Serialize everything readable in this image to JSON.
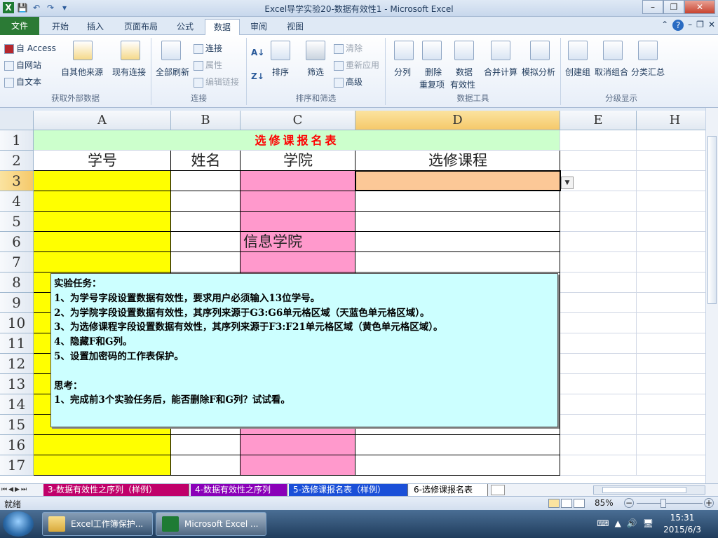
{
  "window": {
    "title": "Excel导学实验20-数据有效性1 - Microsoft Excel",
    "qat": [
      "💾",
      "↶",
      "↷",
      "▾"
    ],
    "controls": {
      "minimize": "–",
      "restore": "❐",
      "close": "✕"
    }
  },
  "tabs": [
    "文件",
    "开始",
    "插入",
    "页面布局",
    "公式",
    "数据",
    "审阅",
    "视图"
  ],
  "active_tab": "数据",
  "tab_right": [
    "⌃",
    "?",
    "–",
    "❐",
    "✕"
  ],
  "ribbon": {
    "get_external": {
      "label": "获取外部数据",
      "access": "自 Access",
      "web": "自网站",
      "text": "自文本",
      "other": "自其他来源",
      "existing": "现有连接"
    },
    "connections": {
      "label": "连接",
      "refresh_all": "全部刷新",
      "connections": "连接",
      "properties": "属性",
      "edit_links": "编辑链接"
    },
    "sort_filter": {
      "label": "排序和筛选",
      "sort_asc": "A↓",
      "sort_desc": "Z↓",
      "sort": "排序",
      "filter": "筛选",
      "clear": "清除",
      "reapply": "重新应用",
      "advanced": "高级"
    },
    "data_tools": {
      "label": "数据工具",
      "split": "分列",
      "remove_dup_1": "删除",
      "remove_dup_2": "重复项",
      "validation_1": "数据",
      "validation_2": "有效性",
      "consolidate": "合并计算",
      "what_if": "模拟分析"
    },
    "outline": {
      "label": "分级显示",
      "group": "创建组",
      "ungroup": "取消组合",
      "subtotal": "分类汇总"
    }
  },
  "columns": [
    "A",
    "B",
    "C",
    "D",
    "E",
    "H"
  ],
  "rows": [
    "1",
    "2",
    "3",
    "4",
    "5",
    "6",
    "7",
    "8",
    "9",
    "10",
    "11",
    "12",
    "13",
    "14",
    "15",
    "16",
    "17"
  ],
  "sheet": {
    "title": "选修课报名表",
    "headers": {
      "a": "学号",
      "b": "姓名",
      "c": "学院",
      "d": "选修课程"
    },
    "c6": "信息学院"
  },
  "note": {
    "lines": [
      "实验任务：",
      "1、为学号字段设置数据有效性，要求用户必须输入13位学号。",
      "2、为学院字段设置数据有效性，其序列来源于G3:G6单元格区域（天蓝色单元格区域）。",
      "3、为选修课程字段设置数据有效性，其序列来源于F3:F21单元格区域（黄色单元格区域）。",
      "4、隐藏F和G列。",
      "5、设置加密码的工作表保护。",
      "",
      "思考：",
      "1、完成前3个实验任务后，能否删除F和G列？试试看。"
    ]
  },
  "sheet_tabs": [
    {
      "label": "3-数据有效性之序列（样例）",
      "color": "#c0006a"
    },
    {
      "label": "4-数据有效性之序列",
      "color": "#8a00b8"
    },
    {
      "label": "5-选修课报名表（样例）",
      "color": "#1a4fd8"
    },
    {
      "label": "6-选修课报名表",
      "color": "#ffffff"
    }
  ],
  "sheet_nav": [
    "⏮",
    "◀",
    "▶",
    "⏭"
  ],
  "status": {
    "ready": "就绪",
    "zoom": "85%",
    "zoom_minus": "−",
    "zoom_plus": "+"
  },
  "taskbar": {
    "items": [
      "Excel工作簿保护...",
      "Microsoft Excel ..."
    ],
    "time": "15:31",
    "date": "2015/6/3",
    "tray": [
      "⌨",
      "▲",
      "🔊",
      "🖥"
    ]
  }
}
